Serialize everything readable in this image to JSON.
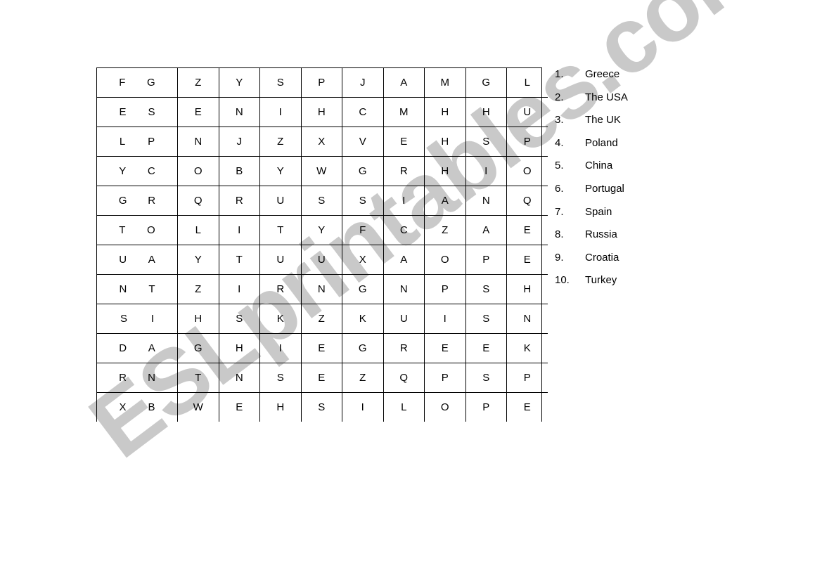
{
  "document": {
    "type": "word-search-worksheet",
    "background_color": "#ffffff",
    "text_color": "#000000"
  },
  "watermark": {
    "text": "ESLprintables.com",
    "color": "#c9c9c9",
    "rotation_degrees": -37
  },
  "puzzle": {
    "rows": 12,
    "columns": 11,
    "border_color": "#000000",
    "letters": [
      [
        "F",
        "G",
        "Z",
        "Y",
        "S",
        "P",
        "J",
        "A",
        "M",
        "G",
        "L"
      ],
      [
        "E",
        "S",
        "E",
        "N",
        "I",
        "H",
        "C",
        "M",
        "H",
        "H",
        "U"
      ],
      [
        "L",
        "P",
        "N",
        "J",
        "Z",
        "X",
        "V",
        "E",
        "H",
        "S",
        "P"
      ],
      [
        "Y",
        "C",
        "O",
        "B",
        "Y",
        "W",
        "G",
        "R",
        "H",
        "I",
        "O"
      ],
      [
        "G",
        "R",
        "Q",
        "R",
        "U",
        "S",
        "S",
        "I",
        "A",
        "N",
        "Q"
      ],
      [
        "T",
        "O",
        "L",
        "I",
        "T",
        "Y",
        "F",
        "C",
        "Z",
        "A",
        "E"
      ],
      [
        "U",
        "A",
        "Y",
        "T",
        "U",
        "U",
        "X",
        "A",
        "O",
        "P",
        "E"
      ],
      [
        "N",
        "T",
        "Z",
        "I",
        "R",
        "N",
        "G",
        "N",
        "P",
        "S",
        "H"
      ],
      [
        "S",
        "I",
        "H",
        "S",
        "K",
        "Z",
        "K",
        "U",
        "I",
        "S",
        "N"
      ],
      [
        "D",
        "A",
        "G",
        "H",
        "I",
        "E",
        "G",
        "R",
        "E",
        "E",
        "K"
      ],
      [
        "R",
        "N",
        "T",
        "N",
        "S",
        "E",
        "Z",
        "Q",
        "P",
        "S",
        "P"
      ],
      [
        "X",
        "B",
        "W",
        "E",
        "H",
        "S",
        "I",
        "L",
        "O",
        "P",
        "E"
      ]
    ]
  },
  "word_list": {
    "items": [
      {
        "number": "1.",
        "label": "Greece"
      },
      {
        "number": "2.",
        "label": "The USA"
      },
      {
        "number": "3.",
        "label": "The UK"
      },
      {
        "number": "4.",
        "label": "Poland"
      },
      {
        "number": "5.",
        "label": "China"
      },
      {
        "number": "6.",
        "label": "Portugal"
      },
      {
        "number": "7.",
        "label": "Spain"
      },
      {
        "number": "8.",
        "label": "Russia"
      },
      {
        "number": "9.",
        "label": "Croatia"
      },
      {
        "number": "10.",
        "label": "Turkey"
      }
    ]
  }
}
